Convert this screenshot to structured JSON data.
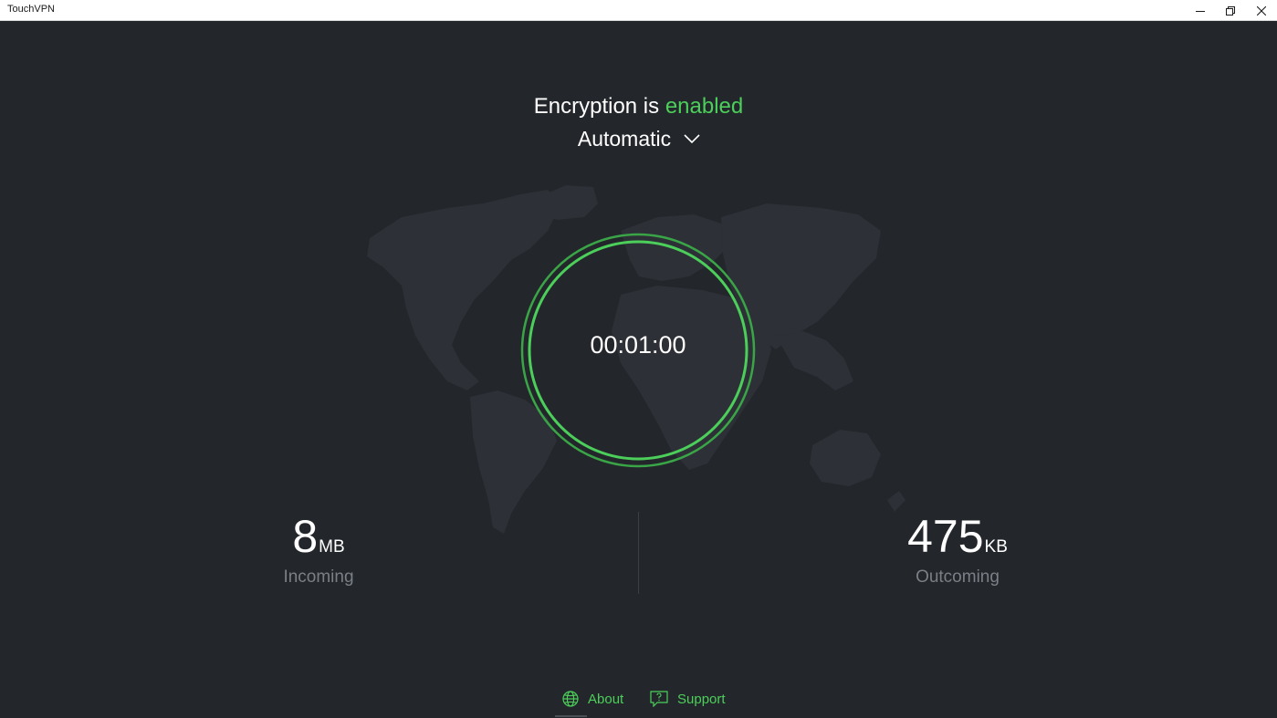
{
  "window": {
    "title": "TouchVPN"
  },
  "status": {
    "prefix": "Encryption is ",
    "state": "enabled",
    "mode": "Automatic"
  },
  "connection": {
    "timer": "00:01:00"
  },
  "stats": {
    "incoming": {
      "value": "8",
      "unit": "MB",
      "label": "Incoming"
    },
    "outgoing": {
      "value": "475",
      "unit": "KB",
      "label": "Outcoming"
    }
  },
  "nav": {
    "about_label": "About",
    "support_label": "Support",
    "selected": "About"
  },
  "theme": {
    "background": "#23262b",
    "accent": "#4ccf5a",
    "muted_text": "#7b7f86",
    "map_land": "#2d3036"
  },
  "icons": {
    "minimize": "minimize-icon",
    "restore": "restore-icon",
    "close": "close-icon",
    "dropdown": "chevron-down-icon",
    "about": "globe-icon",
    "support": "chat-question-icon"
  }
}
